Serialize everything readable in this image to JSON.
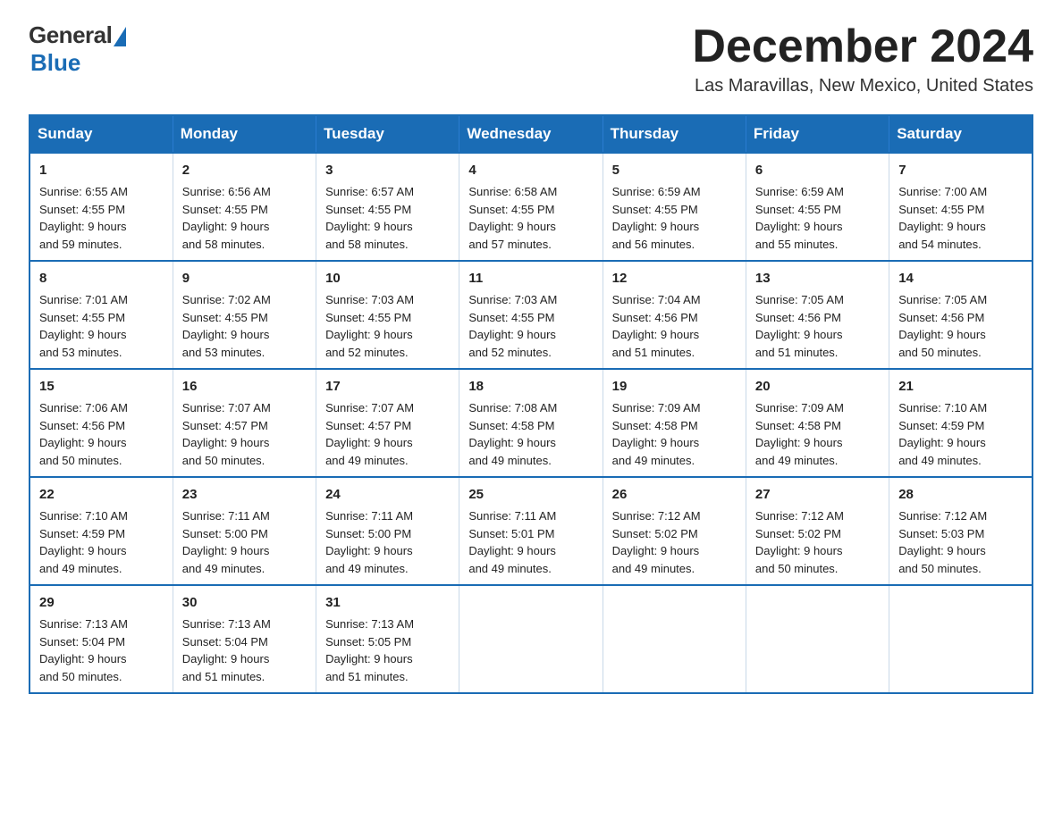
{
  "logo": {
    "general": "General",
    "blue": "Blue"
  },
  "title": "December 2024",
  "location": "Las Maravillas, New Mexico, United States",
  "days_of_week": [
    "Sunday",
    "Monday",
    "Tuesday",
    "Wednesday",
    "Thursday",
    "Friday",
    "Saturday"
  ],
  "weeks": [
    [
      {
        "day": "1",
        "sunrise": "6:55 AM",
        "sunset": "4:55 PM",
        "daylight": "9 hours and 59 minutes."
      },
      {
        "day": "2",
        "sunrise": "6:56 AM",
        "sunset": "4:55 PM",
        "daylight": "9 hours and 58 minutes."
      },
      {
        "day": "3",
        "sunrise": "6:57 AM",
        "sunset": "4:55 PM",
        "daylight": "9 hours and 58 minutes."
      },
      {
        "day": "4",
        "sunrise": "6:58 AM",
        "sunset": "4:55 PM",
        "daylight": "9 hours and 57 minutes."
      },
      {
        "day": "5",
        "sunrise": "6:59 AM",
        "sunset": "4:55 PM",
        "daylight": "9 hours and 56 minutes."
      },
      {
        "day": "6",
        "sunrise": "6:59 AM",
        "sunset": "4:55 PM",
        "daylight": "9 hours and 55 minutes."
      },
      {
        "day": "7",
        "sunrise": "7:00 AM",
        "sunset": "4:55 PM",
        "daylight": "9 hours and 54 minutes."
      }
    ],
    [
      {
        "day": "8",
        "sunrise": "7:01 AM",
        "sunset": "4:55 PM",
        "daylight": "9 hours and 53 minutes."
      },
      {
        "day": "9",
        "sunrise": "7:02 AM",
        "sunset": "4:55 PM",
        "daylight": "9 hours and 53 minutes."
      },
      {
        "day": "10",
        "sunrise": "7:03 AM",
        "sunset": "4:55 PM",
        "daylight": "9 hours and 52 minutes."
      },
      {
        "day": "11",
        "sunrise": "7:03 AM",
        "sunset": "4:55 PM",
        "daylight": "9 hours and 52 minutes."
      },
      {
        "day": "12",
        "sunrise": "7:04 AM",
        "sunset": "4:56 PM",
        "daylight": "9 hours and 51 minutes."
      },
      {
        "day": "13",
        "sunrise": "7:05 AM",
        "sunset": "4:56 PM",
        "daylight": "9 hours and 51 minutes."
      },
      {
        "day": "14",
        "sunrise": "7:05 AM",
        "sunset": "4:56 PM",
        "daylight": "9 hours and 50 minutes."
      }
    ],
    [
      {
        "day": "15",
        "sunrise": "7:06 AM",
        "sunset": "4:56 PM",
        "daylight": "9 hours and 50 minutes."
      },
      {
        "day": "16",
        "sunrise": "7:07 AM",
        "sunset": "4:57 PM",
        "daylight": "9 hours and 50 minutes."
      },
      {
        "day": "17",
        "sunrise": "7:07 AM",
        "sunset": "4:57 PM",
        "daylight": "9 hours and 49 minutes."
      },
      {
        "day": "18",
        "sunrise": "7:08 AM",
        "sunset": "4:58 PM",
        "daylight": "9 hours and 49 minutes."
      },
      {
        "day": "19",
        "sunrise": "7:09 AM",
        "sunset": "4:58 PM",
        "daylight": "9 hours and 49 minutes."
      },
      {
        "day": "20",
        "sunrise": "7:09 AM",
        "sunset": "4:58 PM",
        "daylight": "9 hours and 49 minutes."
      },
      {
        "day": "21",
        "sunrise": "7:10 AM",
        "sunset": "4:59 PM",
        "daylight": "9 hours and 49 minutes."
      }
    ],
    [
      {
        "day": "22",
        "sunrise": "7:10 AM",
        "sunset": "4:59 PM",
        "daylight": "9 hours and 49 minutes."
      },
      {
        "day": "23",
        "sunrise": "7:11 AM",
        "sunset": "5:00 PM",
        "daylight": "9 hours and 49 minutes."
      },
      {
        "day": "24",
        "sunrise": "7:11 AM",
        "sunset": "5:00 PM",
        "daylight": "9 hours and 49 minutes."
      },
      {
        "day": "25",
        "sunrise": "7:11 AM",
        "sunset": "5:01 PM",
        "daylight": "9 hours and 49 minutes."
      },
      {
        "day": "26",
        "sunrise": "7:12 AM",
        "sunset": "5:02 PM",
        "daylight": "9 hours and 49 minutes."
      },
      {
        "day": "27",
        "sunrise": "7:12 AM",
        "sunset": "5:02 PM",
        "daylight": "9 hours and 50 minutes."
      },
      {
        "day": "28",
        "sunrise": "7:12 AM",
        "sunset": "5:03 PM",
        "daylight": "9 hours and 50 minutes."
      }
    ],
    [
      {
        "day": "29",
        "sunrise": "7:13 AM",
        "sunset": "5:04 PM",
        "daylight": "9 hours and 50 minutes."
      },
      {
        "day": "30",
        "sunrise": "7:13 AM",
        "sunset": "5:04 PM",
        "daylight": "9 hours and 51 minutes."
      },
      {
        "day": "31",
        "sunrise": "7:13 AM",
        "sunset": "5:05 PM",
        "daylight": "9 hours and 51 minutes."
      },
      null,
      null,
      null,
      null
    ]
  ],
  "labels": {
    "sunrise": "Sunrise:",
    "sunset": "Sunset:",
    "daylight": "Daylight:"
  }
}
